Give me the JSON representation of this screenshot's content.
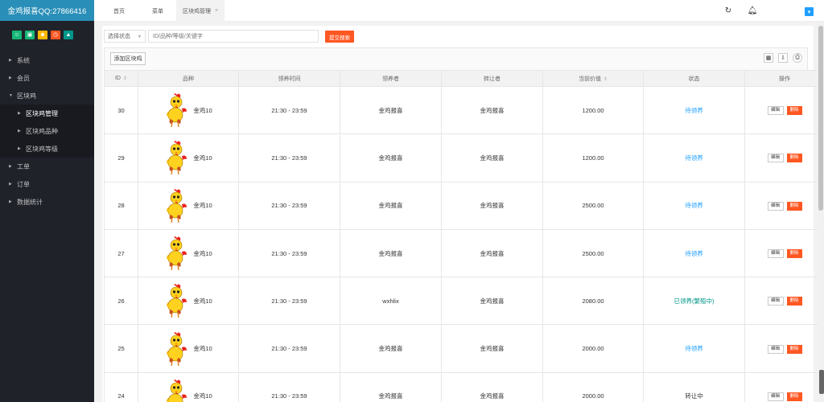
{
  "app": {
    "title": "金鸡报喜QQ:27866416"
  },
  "sidebar": {
    "quick_icons": [
      {
        "icon": "user-icon",
        "color": "#16b777",
        "glyph": "☺"
      },
      {
        "icon": "lock-icon",
        "color": "#16b777",
        "glyph": "▣"
      },
      {
        "icon": "smile-icon",
        "color": "#ffb800",
        "glyph": "☻"
      },
      {
        "icon": "clock-icon",
        "color": "#ff5722",
        "glyph": "◷"
      },
      {
        "icon": "cap-icon",
        "color": "#009688",
        "glyph": "▲"
      }
    ],
    "items": [
      {
        "label": "系统"
      },
      {
        "label": "会员"
      },
      {
        "label": "区块鸡"
      },
      {
        "label": "工单"
      },
      {
        "label": "订单"
      },
      {
        "label": "数据统计"
      }
    ],
    "sub_items": [
      {
        "label": "区块鸡管理"
      },
      {
        "label": "区块鸡品种"
      },
      {
        "label": "区块鸡等级"
      }
    ]
  },
  "tabs": [
    {
      "label": "首页"
    },
    {
      "label": "菜单"
    },
    {
      "label": "区块鸡管理",
      "close": "×"
    }
  ],
  "search": {
    "status_select": "选择状态",
    "keyword_placeholder": "ID/品种/等级/关键字",
    "submit_label": "提交搜索"
  },
  "toolbar": {
    "add_label": "添加区块鸡"
  },
  "table": {
    "headers": [
      "ID",
      "品种",
      "领养时间",
      "领养者",
      "转让者",
      "当前价值",
      "状态",
      "操作"
    ],
    "edit_label": "编辑",
    "delete_label": "删除",
    "rows": [
      {
        "id": "30",
        "breed": "金鸡10",
        "time": "21:30 - 23:59",
        "adopter": "金鸡报喜",
        "transferor": "金鸡报喜",
        "value": "1200.00",
        "status": "待领养"
      },
      {
        "id": "29",
        "breed": "金鸡10",
        "time": "21:30 - 23:59",
        "adopter": "金鸡报喜",
        "transferor": "金鸡报喜",
        "value": "1200.00",
        "status": "待领养"
      },
      {
        "id": "28",
        "breed": "金鸡10",
        "time": "21:30 - 23:59",
        "adopter": "金鸡报喜",
        "transferor": "金鸡报喜",
        "value": "2500.00",
        "status": "待领养"
      },
      {
        "id": "27",
        "breed": "金鸡10",
        "time": "21:30 - 23:59",
        "adopter": "金鸡报喜",
        "transferor": "金鸡报喜",
        "value": "2500.00",
        "status": "待领养"
      },
      {
        "id": "26",
        "breed": "金鸡10",
        "time": "21:30 - 23:59",
        "adopter": "wxhlix",
        "transferor": "金鸡报喜",
        "value": "2080.00",
        "status": "已领养(繁殖中)"
      },
      {
        "id": "25",
        "breed": "金鸡10",
        "time": "21:30 - 23:59",
        "adopter": "金鸡报喜",
        "transferor": "金鸡报喜",
        "value": "2000.00",
        "status": "待领养"
      },
      {
        "id": "24",
        "breed": "金鸡10",
        "time": "21:30 - 23:59",
        "adopter": "金鸡报喜",
        "transferor": "金鸡报喜",
        "value": "2000.00",
        "status": "转让中"
      }
    ]
  }
}
